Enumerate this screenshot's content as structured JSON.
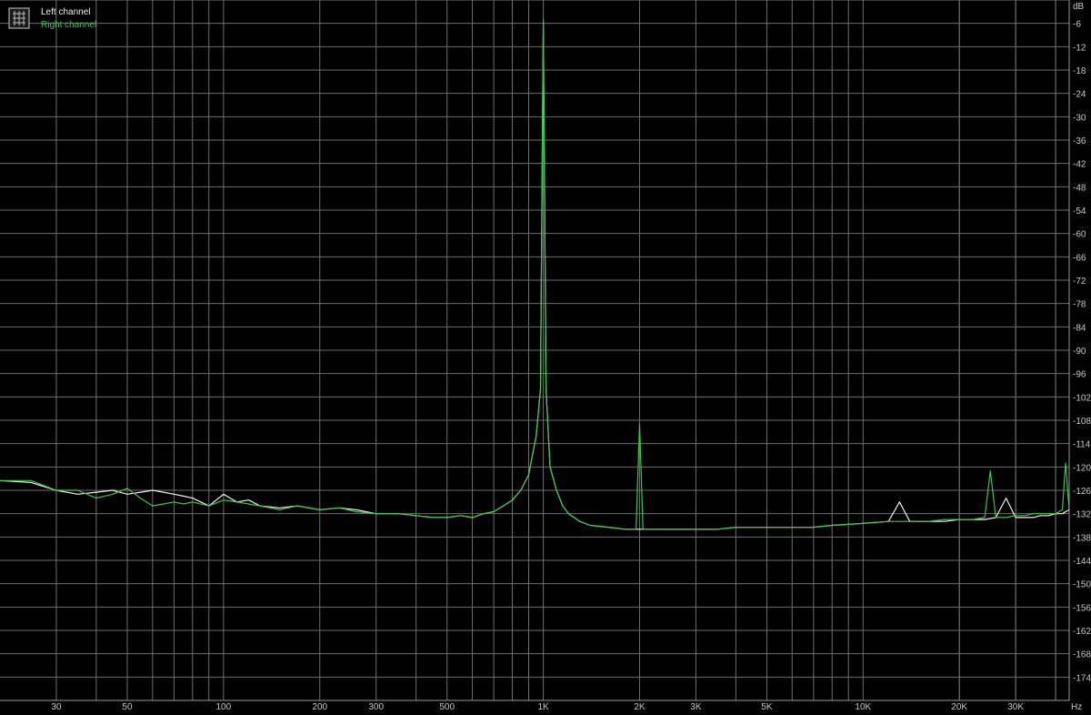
{
  "chart_data": {
    "type": "line",
    "title": "",
    "xlabel": "",
    "ylabel": "",
    "x_unit": "Hz",
    "y_unit": "dB",
    "x_scale": "log",
    "xlim": [
      20,
      44100
    ],
    "ylim": [
      -180,
      0
    ],
    "grid": true,
    "legend_position": "top-left",
    "background_color": "#000000",
    "grid_color": "#6e6e6e",
    "x_ticks": [
      {
        "value": 30,
        "label": "30"
      },
      {
        "value": 50,
        "label": "50"
      },
      {
        "value": 100,
        "label": "100"
      },
      {
        "value": 200,
        "label": "200"
      },
      {
        "value": 300,
        "label": "300"
      },
      {
        "value": 500,
        "label": "500"
      },
      {
        "value": 1000,
        "label": "1K"
      },
      {
        "value": 2000,
        "label": "2K"
      },
      {
        "value": 3000,
        "label": "3K"
      },
      {
        "value": 5000,
        "label": "5K"
      },
      {
        "value": 10000,
        "label": "10K"
      },
      {
        "value": 20000,
        "label": "20K"
      },
      {
        "value": 30000,
        "label": "30K"
      }
    ],
    "y_ticks": [
      -6,
      -12,
      -18,
      -24,
      -30,
      -36,
      -42,
      -48,
      -54,
      -60,
      -66,
      -72,
      -78,
      -84,
      -90,
      -96,
      -102,
      -108,
      -114,
      -120,
      -126,
      -132,
      -138,
      -144,
      -150,
      -156,
      -162,
      -168,
      -174
    ],
    "series": [
      {
        "name": "Left channel",
        "color": "#f0f0f0",
        "x": [
          20,
          25,
          30,
          35,
          40,
          45,
          50,
          55,
          60,
          65,
          70,
          75,
          80,
          90,
          100,
          110,
          120,
          130,
          150,
          170,
          200,
          230,
          260,
          300,
          350,
          400,
          450,
          500,
          550,
          600,
          650,
          700,
          750,
          800,
          850,
          900,
          950,
          980,
          1000,
          1020,
          1050,
          1100,
          1150,
          1200,
          1300,
          1400,
          1600,
          1800,
          2000,
          2200,
          2500,
          3000,
          3500,
          4000,
          5000,
          6000,
          7000,
          8000,
          10000,
          12000,
          13000,
          14000,
          15000,
          16000,
          18000,
          20000,
          22000,
          24000,
          26000,
          28000,
          30000,
          32000,
          34000,
          36000,
          38000,
          40000,
          42000,
          44100
        ],
        "y": [
          -123.5,
          -124,
          -126,
          -127,
          -126.5,
          -126,
          -127,
          -126.5,
          -126,
          -126.5,
          -127,
          -127.5,
          -128,
          -130,
          -127,
          -129,
          -128.5,
          -130,
          -130.5,
          -130,
          -131,
          -130.5,
          -131,
          -132,
          -132,
          -132.5,
          -133,
          -133,
          -132.5,
          -133,
          -132,
          -131.5,
          -130,
          -128.5,
          -126,
          -122,
          -112,
          -100,
          -6,
          -100,
          -120,
          -126,
          -130,
          -132,
          -134,
          -135,
          -135.5,
          -136,
          -136,
          -136,
          -136,
          -136,
          -136,
          -135.5,
          -135.5,
          -135.5,
          -135.5,
          -135,
          -134.5,
          -134,
          -129,
          -134,
          -134,
          -134,
          -134,
          -133.5,
          -133.5,
          -133.5,
          -133,
          -128,
          -133,
          -133,
          -133,
          -132.5,
          -132.5,
          -132,
          -132,
          -131
        ]
      },
      {
        "name": "Right channel",
        "color": "#3fc44a",
        "x": [
          20,
          25,
          30,
          35,
          40,
          45,
          50,
          55,
          60,
          65,
          70,
          75,
          80,
          90,
          100,
          110,
          120,
          130,
          150,
          170,
          200,
          230,
          260,
          300,
          350,
          400,
          450,
          500,
          550,
          600,
          650,
          700,
          750,
          800,
          850,
          900,
          950,
          980,
          1000,
          1020,
          1050,
          1100,
          1150,
          1200,
          1300,
          1400,
          1600,
          1800,
          1950,
          2000,
          2050,
          2200,
          2500,
          3000,
          3500,
          4000,
          5000,
          6000,
          7000,
          8000,
          10000,
          12000,
          14000,
          16000,
          18000,
          20000,
          22000,
          24000,
          25000,
          26000,
          28000,
          30000,
          32000,
          34000,
          36000,
          38000,
          40000,
          42000,
          43000,
          44100
        ],
        "y": [
          -123.5,
          -123.5,
          -126,
          -126,
          -128,
          -127,
          -125.5,
          -128,
          -130,
          -129.5,
          -129,
          -129.5,
          -129,
          -130,
          -128.5,
          -129,
          -129.5,
          -130,
          -131,
          -130,
          -131,
          -130.5,
          -131.5,
          -132,
          -132,
          -132.5,
          -133,
          -133,
          -132.5,
          -133,
          -132,
          -131.5,
          -130,
          -128.5,
          -126,
          -122,
          -112,
          -100,
          -5,
          -100,
          -120,
          -126,
          -130,
          -132,
          -134,
          -135,
          -135.5,
          -136,
          -136,
          -109,
          -136,
          -136,
          -136,
          -136,
          -136,
          -135.5,
          -135.5,
          -135.5,
          -135.5,
          -135,
          -134.5,
          -134,
          -134,
          -134,
          -133.5,
          -133.5,
          -133.5,
          -133,
          -121,
          -133,
          -133,
          -132.5,
          -132.5,
          -132,
          -132,
          -132,
          -132,
          -131,
          -119,
          -131
        ]
      }
    ]
  }
}
